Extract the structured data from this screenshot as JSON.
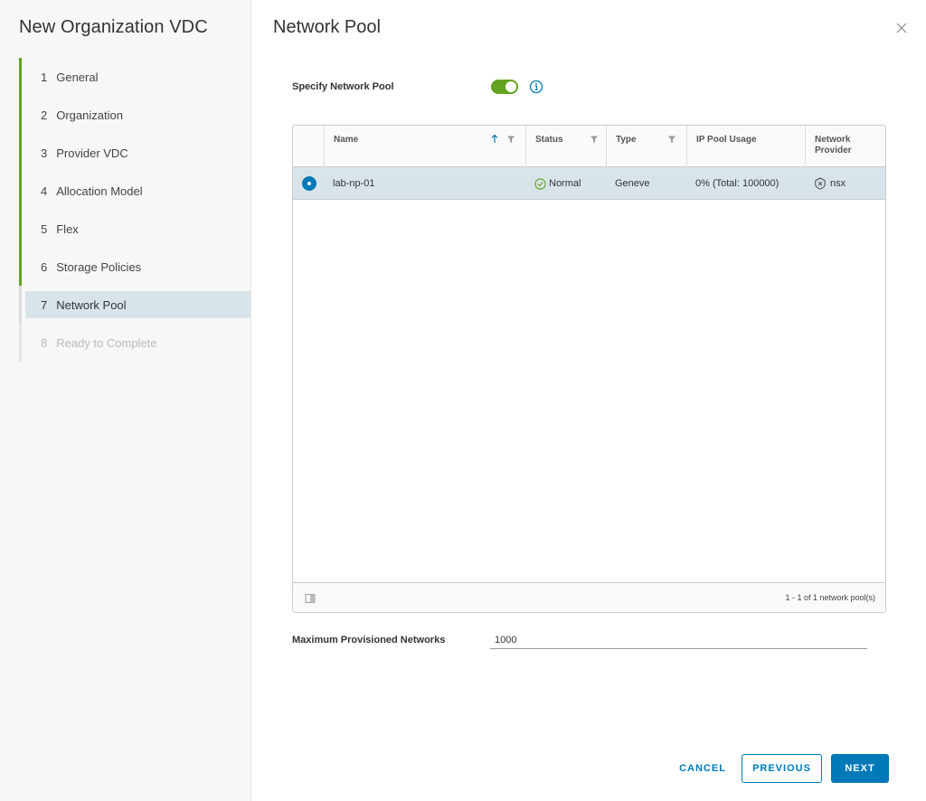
{
  "wizard": {
    "title": "New Organization VDC",
    "steps": [
      {
        "num": "1",
        "label": "General"
      },
      {
        "num": "2",
        "label": "Organization"
      },
      {
        "num": "3",
        "label": "Provider VDC"
      },
      {
        "num": "4",
        "label": "Allocation Model"
      },
      {
        "num": "5",
        "label": "Flex"
      },
      {
        "num": "6",
        "label": "Storage Policies"
      },
      {
        "num": "7",
        "label": "Network Pool"
      },
      {
        "num": "8",
        "label": "Ready to Complete"
      }
    ]
  },
  "page": {
    "title": "Network Pool",
    "specify_label": "Specify Network Pool"
  },
  "grid": {
    "columns": {
      "name": "Name",
      "status": "Status",
      "type": "Type",
      "ip_pool_usage": "IP Pool Usage",
      "network_provider_1": "Network",
      "network_provider_2": "Provider"
    },
    "rows": [
      {
        "name": "lab-np-01",
        "status": "Normal",
        "type": "Geneve",
        "ip_pool_usage": "0% (Total: 100000)",
        "network_provider": "nsx"
      }
    ],
    "footer": "1 - 1 of 1 network pool(s)"
  },
  "max_networks": {
    "label": "Maximum Provisioned Networks",
    "value": "1000"
  },
  "buttons": {
    "cancel": "CANCEL",
    "previous": "PREVIOUS",
    "next": "NEXT"
  },
  "colors": {
    "accent": "#0079b8",
    "success": "#62a420",
    "selected_row": "#d9e4ea"
  }
}
